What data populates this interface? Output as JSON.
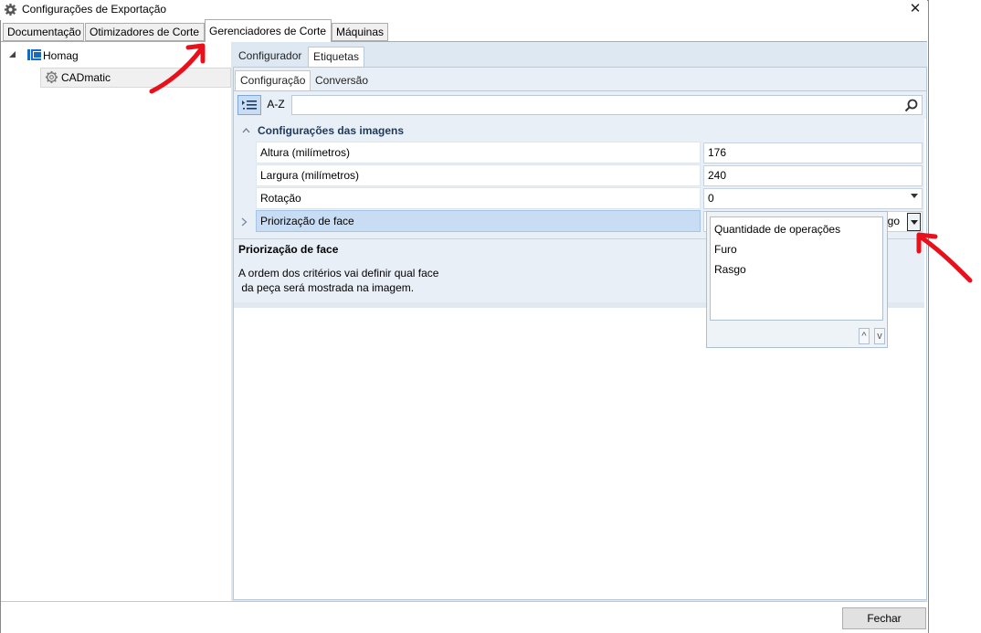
{
  "window": {
    "title": "Configurações de Exportação",
    "close_glyph": "✕"
  },
  "tabs": [
    {
      "label": "Documentação"
    },
    {
      "label": "Otimizadores de Corte"
    },
    {
      "label": "Gerenciadores de Corte"
    },
    {
      "label": "Máquinas"
    }
  ],
  "tree": {
    "root": {
      "label": "Homag",
      "icon": "homag-logo-icon"
    },
    "child": {
      "label": "CADmatic",
      "icon": "gear-icon"
    }
  },
  "subtabs": [
    {
      "label": "Configurador"
    },
    {
      "label": "Etiquetas"
    }
  ],
  "innertabs": [
    {
      "label": "Configuração"
    },
    {
      "label": "Conversão"
    }
  ],
  "toolbar": {
    "az_label": "A-Z",
    "search_placeholder": ""
  },
  "grid": {
    "category": "Configurações das imagens",
    "properties": [
      {
        "name": "Altura (milímetros)",
        "value": "176"
      },
      {
        "name": "Largura (milímetros)",
        "value": "240"
      },
      {
        "name": "Rotação",
        "value": "0"
      },
      {
        "name": "Priorização de face",
        "value": "go"
      }
    ]
  },
  "description": {
    "title": "Priorização de face",
    "line1": "A ordem dos critérios vai definir qual face",
    "line2": " da peça será mostrada na imagem."
  },
  "dropdown": {
    "items": [
      "Quantidade de operações",
      "Furo",
      "Rasgo"
    ],
    "up_label": "^",
    "down_label": "v"
  },
  "footer": {
    "close_label": "Fechar"
  },
  "colors": {
    "accent_arrow": "#e8101a",
    "panel_bg": "#e9eff6"
  }
}
